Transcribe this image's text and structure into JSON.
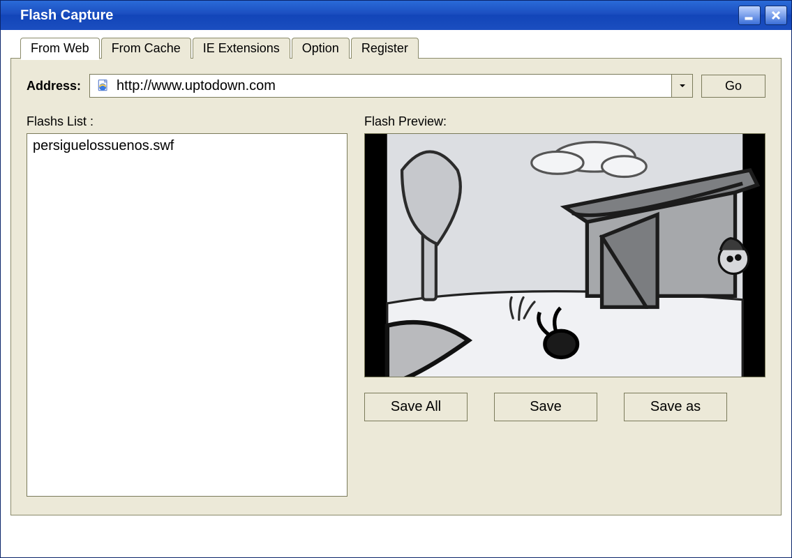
{
  "window": {
    "title": "Flash Capture"
  },
  "tabs": [
    {
      "label": "From Web",
      "active": true
    },
    {
      "label": "From Cache",
      "active": false
    },
    {
      "label": "IE Extensions",
      "active": false
    },
    {
      "label": "Option",
      "active": false
    },
    {
      "label": "Register",
      "active": false
    }
  ],
  "address": {
    "label": "Address:",
    "value": "http://www.uptodown.com"
  },
  "buttons": {
    "go": "Go",
    "saveAll": "Save All",
    "save": "Save",
    "saveAs": "Save as"
  },
  "flashList": {
    "label": "Flashs List :",
    "items": [
      "persiguelossuenos.swf"
    ]
  },
  "preview": {
    "label": "Flash Preview:"
  }
}
